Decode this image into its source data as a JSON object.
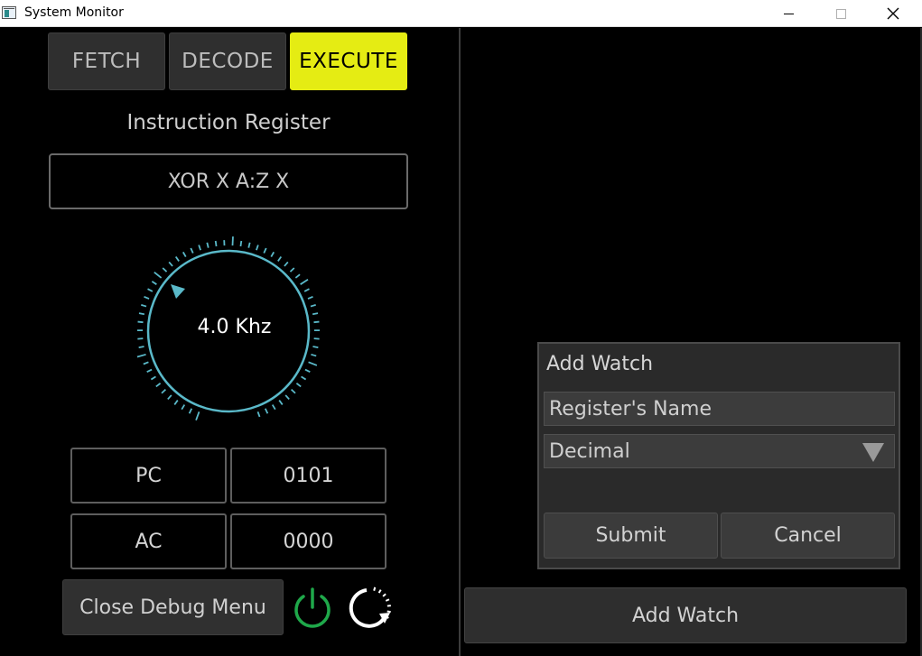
{
  "window": {
    "title": "System Monitor",
    "controls": [
      "minimize",
      "maximize",
      "close"
    ]
  },
  "stages": {
    "fetch": "FETCH",
    "decode": "DECODE",
    "execute": "EXECUTE",
    "active": "EXECUTE",
    "active_color": "#e5ec13"
  },
  "instruction_register": {
    "label": "Instruction Register",
    "value": "XOR X A:Z X"
  },
  "clock_dial": {
    "readout": "4.0 Khz",
    "accent_color": "#5ab9c9"
  },
  "registers": [
    {
      "name": "PC",
      "value": "0101"
    },
    {
      "name": "AC",
      "value": "0000"
    }
  ],
  "debug": {
    "close_label": "Close Debug Menu",
    "power_icon": "power-icon",
    "power_color": "#1fa84a",
    "refresh_icon": "refresh-icon"
  },
  "watch_dialog": {
    "title": "Add Watch",
    "register_name_placeholder": "Register's Name",
    "format_selected": "Decimal",
    "submit_label": "Submit",
    "cancel_label": "Cancel"
  },
  "add_watch_button": "Add Watch"
}
